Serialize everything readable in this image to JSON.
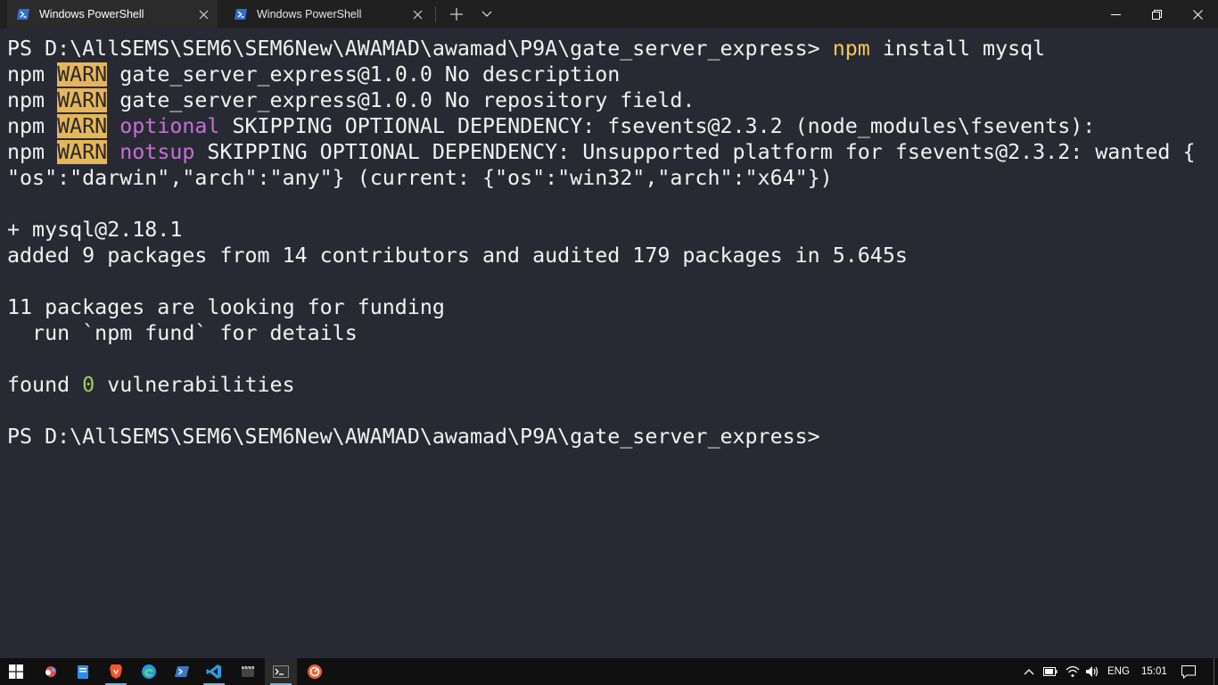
{
  "tabs": [
    {
      "title": "Windows PowerShell",
      "active": true
    },
    {
      "title": "Windows PowerShell",
      "active": false
    }
  ],
  "terminal": {
    "line1": {
      "prompt": "PS D:\\AllSEMS\\SEM6\\SEM6New\\AWAMAD\\awamad\\P9A\\gate_server_express> ",
      "cmd": "npm",
      "args": " install mysql"
    },
    "warn_prefix": "npm ",
    "warn_label": "WARN",
    "line2_rest": " gate_server_express@1.0.0 No description",
    "line3_rest": " gate_server_express@1.0.0 No repository field.",
    "line4_tag": "optional",
    "line4_rest": " SKIPPING OPTIONAL DEPENDENCY: fsevents@2.3.2 (node_modules\\fsevents):",
    "line5_tag": "notsup",
    "line5_rest": " SKIPPING OPTIONAL DEPENDENCY: Unsupported platform for fsevents@2.3.2: wanted {",
    "line6": "\"os\":\"darwin\",\"arch\":\"any\"} (current: {\"os\":\"win32\",\"arch\":\"x64\"})",
    "line7": "+ mysql@2.18.1",
    "line8": "added 9 packages from 14 contributors and audited 179 packages in 5.645s",
    "line9": "11 packages are looking for funding",
    "line10": "  run `npm fund` for details",
    "line11_pre": "found ",
    "line11_num": "0",
    "line11_post": " vulnerabilities",
    "line12": "PS D:\\AllSEMS\\SEM6\\SEM6New\\AWAMAD\\awamad\\P9A\\gate_server_express>"
  },
  "taskbar": {
    "icons": [
      "windows-start-icon",
      "app-icon",
      "file-icon",
      "brave-browser-icon",
      "edge-browser-icon",
      "powershell-icon",
      "vscode-icon",
      "clapperboard-icon",
      "terminal-icon",
      "record-icon"
    ],
    "language": "ENG",
    "time": "15:01"
  },
  "colors": {
    "terminal_bg": "#282a33",
    "titlebar_bg": "#202020",
    "warn_bg": "#e6b65b",
    "command_yellow": "#f5c95a",
    "tag_magenta": "#c86fd6",
    "number_green": "#9bd05e"
  }
}
